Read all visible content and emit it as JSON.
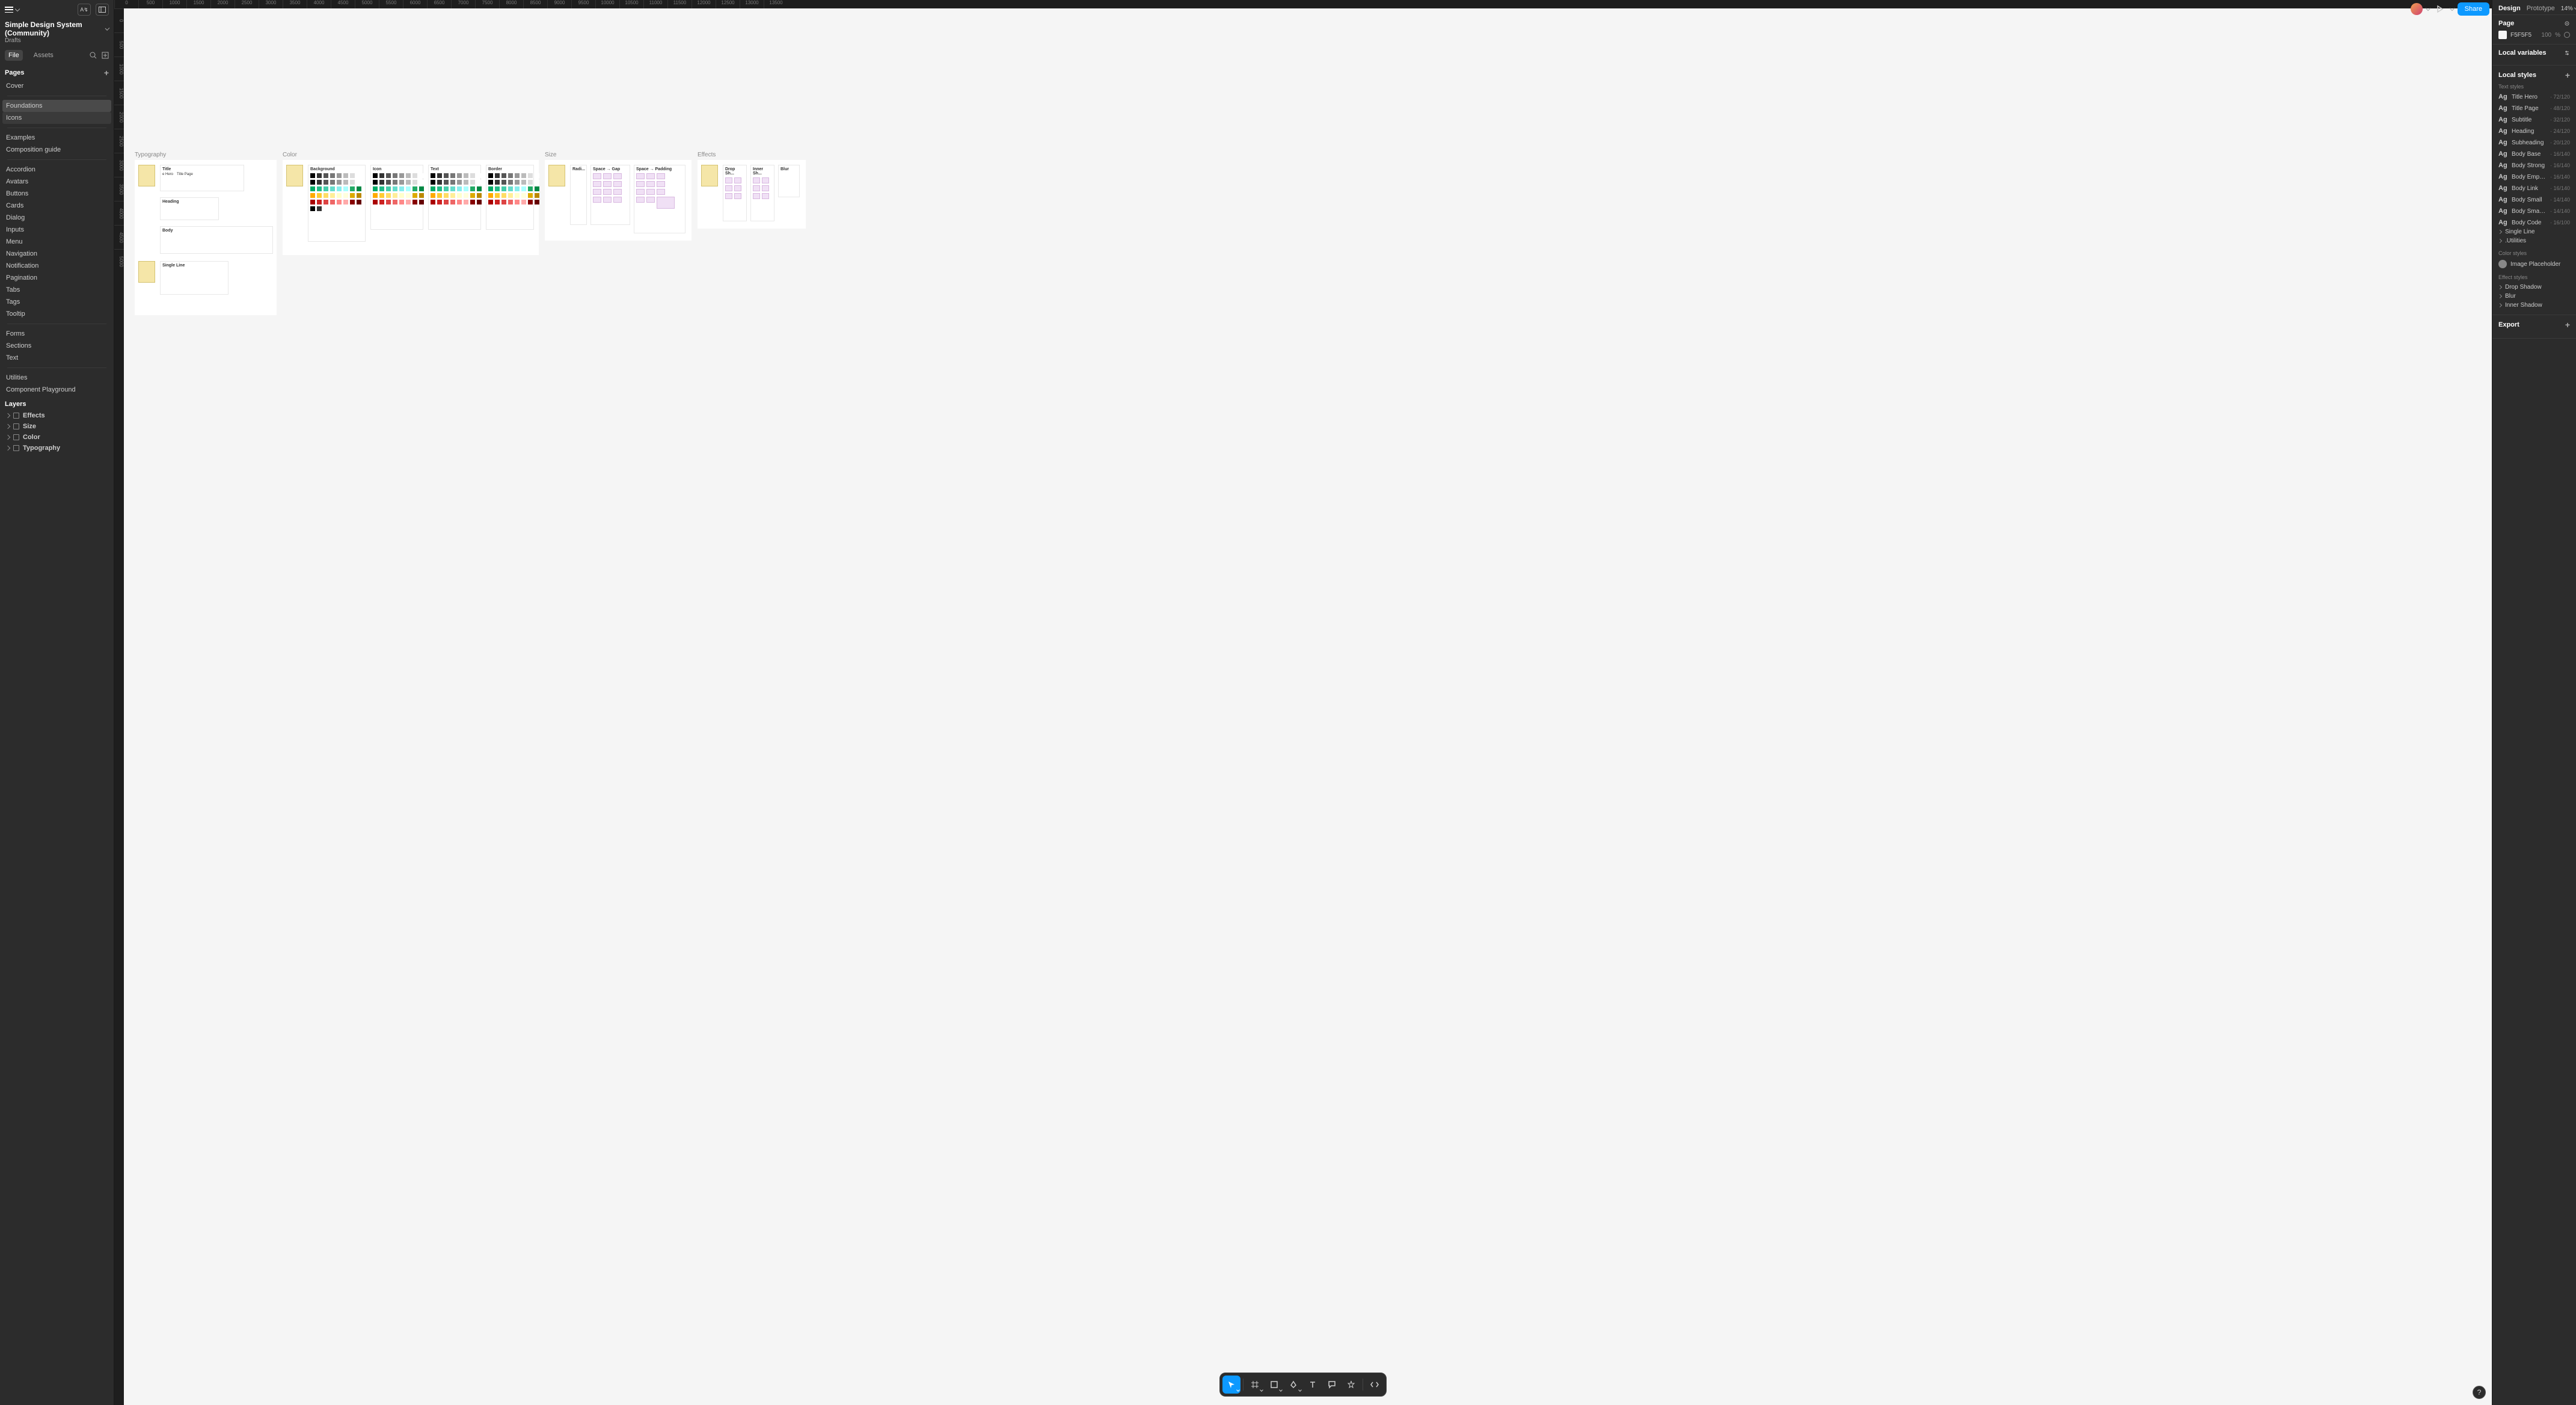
{
  "project": {
    "title": "Simple Design System (Community)",
    "location": "Drafts"
  },
  "leftTabs": {
    "file": "File",
    "assets": "Assets"
  },
  "pagesHeader": "Pages",
  "layersHeader": "Layers",
  "pages": {
    "cover": "Cover",
    "foundations": "Foundations",
    "icons": "Icons",
    "examples": "Examples",
    "compGuide": "Composition guide",
    "accordion": "Accordion",
    "avatars": "Avatars",
    "buttons": "Buttons",
    "cards": "Cards",
    "dialog": "Dialog",
    "inputs": "Inputs",
    "menu": "Menu",
    "navigation": "Navigation",
    "notification": "Notification",
    "pagination": "Pagination",
    "tabs": "Tabs",
    "tags": "Tags",
    "tooltip": "Tooltip",
    "forms": "Forms",
    "sections": "Sections",
    "text": "Text",
    "utilities": "Utilities",
    "compPlayground": "Component Playground"
  },
  "layers": {
    "effects": "Effects",
    "size": "Size",
    "color": "Color",
    "typography": "Typography"
  },
  "canvas": {
    "typography": {
      "label": "Typography",
      "title": "Title",
      "titleHero": "e Hero",
      "titlePage": "Title Page",
      "heading": "Heading",
      "body": "Body",
      "singleLine": "Single Line"
    },
    "color": {
      "label": "Color",
      "background": "Background",
      "icon": "Icon",
      "text": "Text",
      "border": "Border"
    },
    "size": {
      "label": "Size",
      "radius": "Radi...",
      "gap": "Space → Gap",
      "padding": "Space → Padding"
    },
    "effects": {
      "label": "Effects",
      "drop": "Drop Sh...",
      "inner": "Inner Sh...",
      "blur": "Blur"
    }
  },
  "rulerH": [
    "0",
    "500",
    "1000",
    "1500",
    "2000",
    "2500",
    "3000",
    "3500",
    "4000",
    "4500",
    "5000",
    "5500",
    "6000",
    "6500",
    "7000",
    "7500",
    "8000",
    "8500",
    "9000",
    "9500",
    "10000",
    "10500",
    "11000",
    "11500",
    "12000",
    "12500",
    "13000",
    "13500"
  ],
  "rulerV": [
    "0",
    "500",
    "1000",
    "1500",
    "2000",
    "2500",
    "3000",
    "3500",
    "4000",
    "4500",
    "5000"
  ],
  "topRight": {
    "share": "Share"
  },
  "rightPanel": {
    "tabs": {
      "design": "Design",
      "prototype": "Prototype"
    },
    "zoom": "14%",
    "pageHdr": "Page",
    "bgHex": "F5F5F5",
    "bgPct": "100",
    "bgUnit": "%",
    "localVars": "Local variables",
    "localStyles": "Local styles",
    "textStylesHdr": "Text styles",
    "textStyles": [
      {
        "name": "Title Hero",
        "meta": "72/120"
      },
      {
        "name": "Title Page",
        "meta": "48/120"
      },
      {
        "name": "Subtitle",
        "meta": "32/120"
      },
      {
        "name": "Heading",
        "meta": "24/120"
      },
      {
        "name": "Subheading",
        "meta": "20/120"
      },
      {
        "name": "Body Base",
        "meta": "16/140"
      },
      {
        "name": "Body Strong",
        "meta": "16/140"
      },
      {
        "name": "Body Emphasis",
        "meta": "16/140"
      },
      {
        "name": "Body Link",
        "meta": "16/140"
      },
      {
        "name": "Body Small",
        "meta": "14/140"
      },
      {
        "name": "Body Small Strong",
        "meta": "14/140"
      },
      {
        "name": "Body Code",
        "meta": "16/100"
      }
    ],
    "textStyleGroups": {
      "singleLine": "Single Line",
      "utilities": ".Utilities"
    },
    "colorStylesHdr": "Color styles",
    "colorStyle": "Image Placeholder",
    "effectStylesHdr": "Effect styles",
    "effectStyles": {
      "drop": "Drop Shadow",
      "blur": "Blur",
      "inner": "Inner Shadow"
    },
    "exportHdr": "Export"
  },
  "colors": {
    "accent": "#0d99ff",
    "swatchesRow1": [
      "#000",
      "#333",
      "#555",
      "#777",
      "#999",
      "#bbb",
      "#ddd",
      "#fff"
    ],
    "swatchesGreen": [
      "#0a6",
      "#2b8",
      "#4ca",
      "#6dc",
      "#8ee",
      "#aff",
      "#2a6",
      "#084"
    ],
    "swatchesYellow": [
      "#fa0",
      "#fc3",
      "#fd6",
      "#fe9",
      "#ffc",
      "#ffd",
      "#da0",
      "#b80"
    ],
    "swatchesRed": [
      "#a00",
      "#c22",
      "#d44",
      "#e66",
      "#f88",
      "#faa",
      "#800",
      "#600"
    ]
  }
}
